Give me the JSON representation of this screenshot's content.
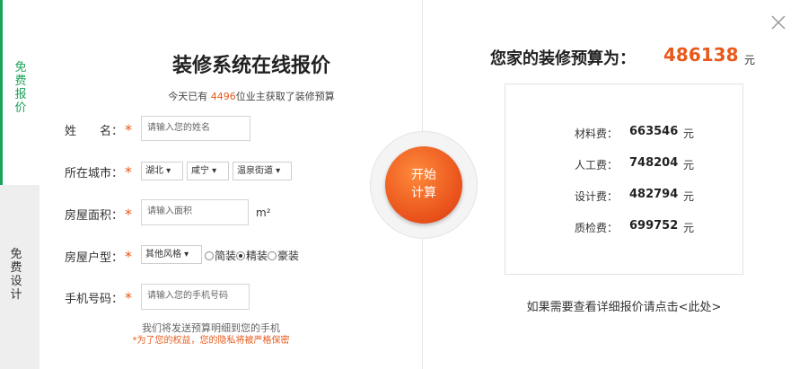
{
  "side_tabs": [
    {
      "label": "免\n费\n报\n价"
    },
    {
      "label": "免\n费\n设\n计"
    }
  ],
  "left": {
    "title": "装修系统在线报价",
    "subtitle_prefix": "今天已有 ",
    "subtitle_count": "4496",
    "subtitle_suffix": "位业主获取了装修预算",
    "fields": {
      "name_label": "姓　　名：",
      "name_placeholder": "请输入您的姓名",
      "city_label": "所在城市：",
      "province": "湖北",
      "city": "咸宁",
      "district": "温泉街道",
      "area_label": "房屋面积：",
      "area_placeholder": "请输入面积",
      "area_unit": "m²",
      "type_label": "房屋户型：",
      "style": "其他风格",
      "decor_options": [
        "简装",
        "精装",
        "豪装"
      ],
      "decor_selected": "精装",
      "phone_label": "手机号码：",
      "phone_placeholder": "请输入您的手机号码"
    },
    "required_mark": "*",
    "note_line1": "我们将发送预算明细到您的手机",
    "note_line2": "*为了您的权益，您的隐私将被严格保密"
  },
  "calc_button": {
    "label": "开始\n计算"
  },
  "right": {
    "budget_label": "您家的装修预算为：",
    "budget_value": "486138",
    "budget_unit": "元",
    "costs": [
      {
        "label": "材料费：",
        "value": "663546",
        "unit": "元"
      },
      {
        "label": "人工费：",
        "value": "748204",
        "unit": "元"
      },
      {
        "label": "设计费：",
        "value": "482794",
        "unit": "元"
      },
      {
        "label": "质检费：",
        "value": "699752",
        "unit": "元"
      }
    ],
    "detail_link": "如果需要查看详细报价请点击<此处>"
  },
  "colors": {
    "accent": "#e8591a",
    "green": "#1aa35a"
  },
  "icons": {
    "close": "close-icon"
  }
}
